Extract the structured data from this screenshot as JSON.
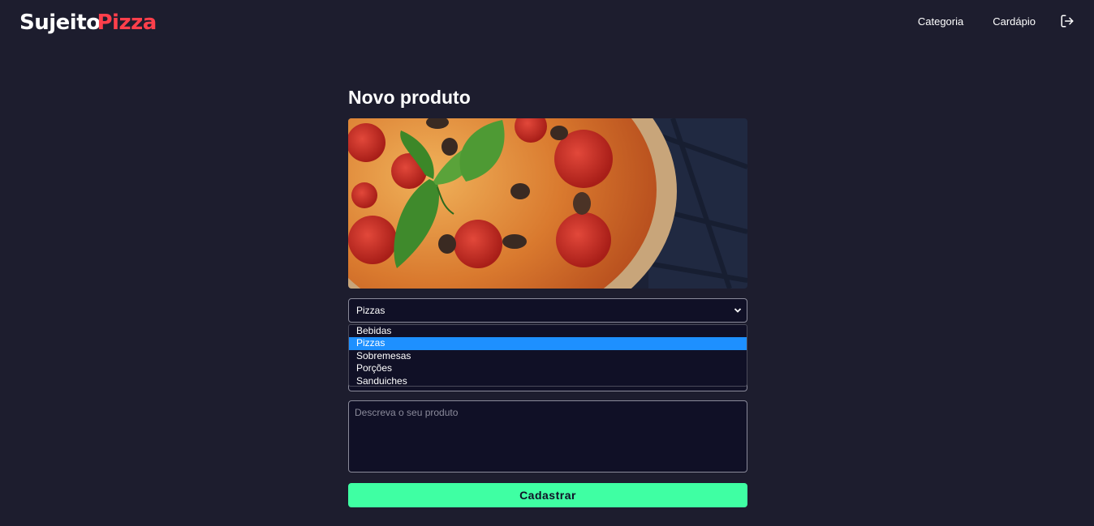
{
  "header": {
    "logo_part1": "Sujeito",
    "logo_part2": "Pizza",
    "nav": [
      "Categoria",
      "Cardápio"
    ],
    "logout_icon": "logout-icon"
  },
  "page": {
    "title": "Novo produto"
  },
  "form": {
    "image_alt": "pizza-photo",
    "category_selected": "Pizzas",
    "category_options": [
      "Bebidas",
      "Pizzas",
      "Sobremesas",
      "Porções",
      "Sanduiches"
    ],
    "description_placeholder": "Descreva o seu produto",
    "submit_label": "Cadastrar"
  },
  "colors": {
    "background": "#1d1d2e",
    "input_bg": "#101026",
    "brand_red": "#ff3f4b",
    "submit_green": "#3fffa3",
    "option_highlight": "#1e90ff"
  }
}
